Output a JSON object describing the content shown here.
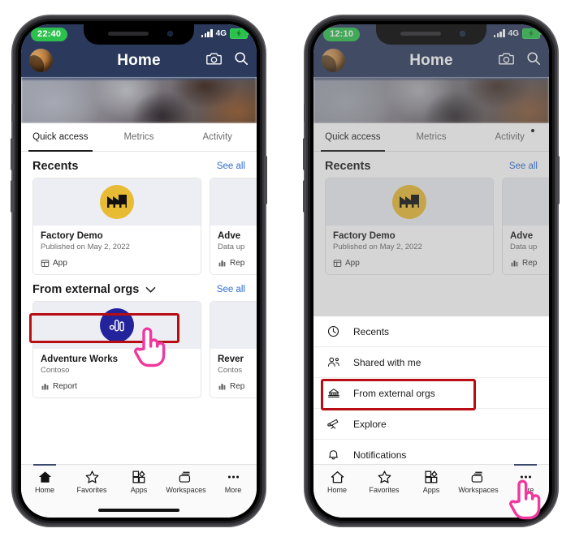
{
  "phones": [
    {
      "id": "left-phone",
      "status": {
        "time": "22:40",
        "network": "4G",
        "battery_state": "charging"
      },
      "appbar": {
        "title": "Home",
        "camera_icon": "camera-icon",
        "search_icon": "search-icon",
        "avatar": "avatar"
      },
      "tabs": [
        {
          "label": "Quick access",
          "active": true,
          "badge": false
        },
        {
          "label": "Metrics",
          "active": false,
          "badge": false
        },
        {
          "label": "Activity",
          "active": false,
          "badge": false
        }
      ],
      "sections": [
        {
          "title": "Recents",
          "see_all": "See all",
          "dropdown": false,
          "cards": [
            {
              "title": "Factory Demo",
              "subtitle": "Published on May 2, 2022",
              "type": "App",
              "icon": "factory-icon"
            },
            {
              "title": "Adve",
              "subtitle": "Data up",
              "type": "Rep",
              "icon": "report-icon"
            }
          ]
        },
        {
          "title": "From external orgs",
          "see_all": "See all",
          "dropdown": true,
          "cards": [
            {
              "title": "Adventure Works",
              "subtitle": "Contoso",
              "type": "Report",
              "icon": "report-icon"
            },
            {
              "title": "Rever",
              "subtitle": "Contos",
              "type": "Rep",
              "icon": "report-icon"
            }
          ]
        }
      ],
      "bottom_nav": [
        {
          "label": "Home",
          "icon": "home-icon",
          "active": true
        },
        {
          "label": "Favorites",
          "icon": "star-icon",
          "active": false
        },
        {
          "label": "Apps",
          "icon": "apps-icon",
          "active": false
        },
        {
          "label": "Workspaces",
          "icon": "workspaces-icon",
          "active": false
        },
        {
          "label": "More",
          "icon": "more-icon",
          "active": false
        }
      ],
      "menu": null,
      "dimmed": false
    },
    {
      "id": "right-phone",
      "status": {
        "time": "12:10",
        "network": "4G",
        "battery_state": "charging"
      },
      "appbar": {
        "title": "Home",
        "camera_icon": "camera-icon",
        "search_icon": "search-icon",
        "avatar": "avatar"
      },
      "tabs": [
        {
          "label": "Quick access",
          "active": true,
          "badge": false
        },
        {
          "label": "Metrics",
          "active": false,
          "badge": false
        },
        {
          "label": "Activity",
          "active": false,
          "badge": true
        }
      ],
      "sections": [
        {
          "title": "Recents",
          "see_all": "See all",
          "dropdown": false,
          "cards": [
            {
              "title": "Factory Demo",
              "subtitle": "Published on May 2, 2022",
              "type": "App",
              "icon": "factory-icon"
            },
            {
              "title": "Adve",
              "subtitle": "Data up",
              "type": "Rep",
              "icon": "report-icon"
            }
          ]
        }
      ],
      "menu": [
        {
          "label": "Recents",
          "icon": "clock-icon",
          "highlighted": false
        },
        {
          "label": "Shared with me",
          "icon": "people-icon",
          "highlighted": false
        },
        {
          "label": "From external orgs",
          "icon": "external-orgs-icon",
          "highlighted": true
        },
        {
          "label": "Explore",
          "icon": "telescope-icon",
          "highlighted": false
        },
        {
          "label": "Notifications",
          "icon": "bell-icon",
          "highlighted": false
        }
      ],
      "bottom_nav": [
        {
          "label": "Home",
          "icon": "home-icon",
          "active": false
        },
        {
          "label": "Favorites",
          "icon": "star-icon",
          "active": false
        },
        {
          "label": "Apps",
          "icon": "apps-icon",
          "active": false
        },
        {
          "label": "Workspaces",
          "icon": "workspaces-icon",
          "active": false
        },
        {
          "label": "More",
          "icon": "more-icon",
          "active": true
        }
      ],
      "dimmed": true
    }
  ],
  "annotations": {
    "highlight_color": "#b80d12",
    "cursor_color": "#f0389e",
    "left_highlight_target": "From external orgs",
    "right_highlight_target": "From external orgs",
    "left_cursor_target": "from-external-orgs-dropdown",
    "right_cursor_target": "more-nav-button"
  }
}
